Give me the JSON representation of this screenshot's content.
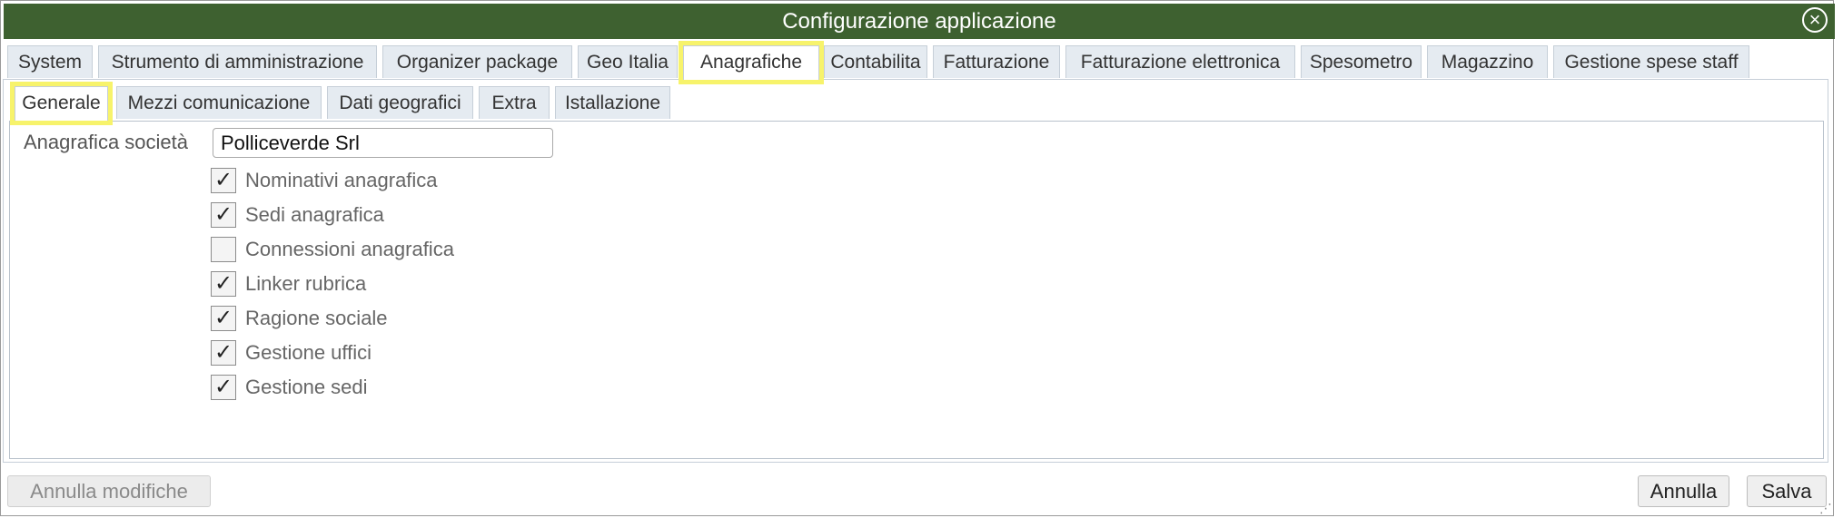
{
  "window": {
    "title": "Configurazione applicazione",
    "close_icon": "close-circle-icon",
    "title_bg": "#3e6130"
  },
  "tabs": [
    {
      "label": "System",
      "active": false
    },
    {
      "label": "Strumento di amministrazione",
      "active": false
    },
    {
      "label": "Organizer package",
      "active": false
    },
    {
      "label": "Geo Italia",
      "active": false
    },
    {
      "label": "Anagrafiche",
      "active": true
    },
    {
      "label": "Contabilita",
      "active": false
    },
    {
      "label": "Fatturazione",
      "active": false
    },
    {
      "label": "Fatturazione elettronica",
      "active": false
    },
    {
      "label": "Spesometro",
      "active": false
    },
    {
      "label": "Magazzino",
      "active": false
    },
    {
      "label": "Gestione spese staff",
      "active": false
    }
  ],
  "subtabs": [
    {
      "label": "Generale",
      "active": true
    },
    {
      "label": "Mezzi comunicazione",
      "active": false
    },
    {
      "label": "Dati geografici",
      "active": false
    },
    {
      "label": "Extra",
      "active": false
    },
    {
      "label": "Istallazione",
      "active": false
    }
  ],
  "form": {
    "company_label": "Anagrafica società",
    "company_value": "Polliceverde Srl",
    "options": [
      {
        "label": "Nominativi anagrafica",
        "checked": true
      },
      {
        "label": "Sedi anagrafica",
        "checked": true
      },
      {
        "label": "Connessioni anagrafica",
        "checked": false
      },
      {
        "label": "Linker rubrica",
        "checked": true
      },
      {
        "label": "Ragione sociale",
        "checked": true
      },
      {
        "label": "Gestione uffici",
        "checked": true
      },
      {
        "label": "Gestione sedi",
        "checked": true
      }
    ]
  },
  "footer": {
    "annulla_modifiche": "Annulla modifiche",
    "annulla": "Annulla",
    "salva": "Salva"
  },
  "highlight_color": "#f7f36b"
}
